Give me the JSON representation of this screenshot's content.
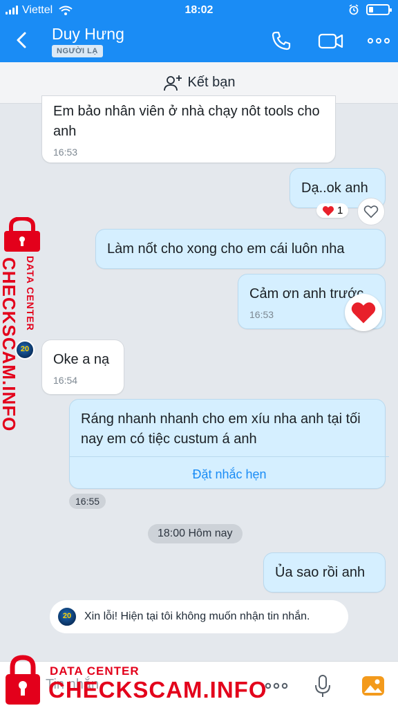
{
  "status_bar": {
    "carrier": "Viettel",
    "time": "18:02"
  },
  "header": {
    "contact_name": "Duy Hưng",
    "tag": "NGƯỜI LẠ"
  },
  "add_friend": {
    "label": "Kết bạn"
  },
  "messages": [
    {
      "text": "Em bảo nhân viên ở nhà chạy nôt tools cho anh",
      "time": "16:53"
    },
    {
      "text": "Dạ..ok anh",
      "reaction_count": "1"
    },
    {
      "text": "Làm nốt cho xong cho em cái luôn nha"
    },
    {
      "text": "Cảm ơn anh trước",
      "time": "16:53"
    },
    {
      "text": "Oke a nạ",
      "time": "16:54"
    },
    {
      "text": "Ráng nhanh nhanh cho em xíu nha anh tại tối nay em có tiệc custum á anh",
      "action": "Đặt nhắc hẹn",
      "time": "16:55"
    },
    {
      "text": "Ủa sao rồi anh"
    }
  ],
  "date_separator": "18:00 Hôm nay",
  "system_message": "Xin lỗi! Hiện tại tôi không muốn nhận tin nhắn.",
  "avatar_text": "20",
  "input": {
    "placeholder": "Tin nhắn"
  },
  "watermark": {
    "small": "DATA CENTER",
    "big": "CHECKSCAM.INFO"
  },
  "colors": {
    "header_blue": "#1a8cf5",
    "outgoing_bubble": "#d5efff",
    "watermark_red": "#e3001b",
    "heart_red": "#e8202a"
  }
}
